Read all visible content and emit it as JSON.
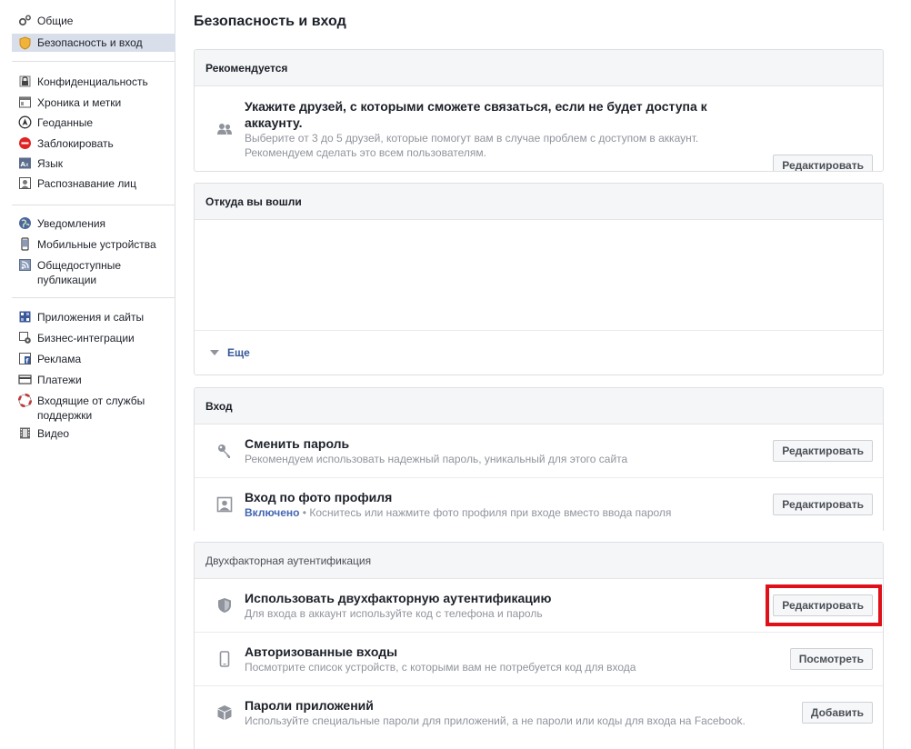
{
  "sidebar": {
    "group1": [
      {
        "label": "Общие",
        "icon": "gears-icon"
      },
      {
        "label": "Безопасность и вход",
        "icon": "shield-badge-icon",
        "active": true
      }
    ],
    "group2": [
      {
        "label": "Конфиденциальность",
        "icon": "lock-icon"
      },
      {
        "label": "Хроника и метки",
        "icon": "timeline-icon"
      },
      {
        "label": "Геоданные",
        "icon": "location-icon"
      },
      {
        "label": "Заблокировать",
        "icon": "block-icon"
      },
      {
        "label": "Язык",
        "icon": "language-icon"
      },
      {
        "label": "Распознавание лиц",
        "icon": "face-recognition-icon"
      }
    ],
    "group3": [
      {
        "label": "Уведомления",
        "icon": "globe-icon"
      },
      {
        "label": "Мобильные устройства",
        "icon": "mobile-icon"
      },
      {
        "label": "Общедоступные публикации",
        "icon": "rss-icon"
      }
    ],
    "group4": [
      {
        "label": "Приложения и сайты",
        "icon": "apps-icon"
      },
      {
        "label": "Бизнес-интеграции",
        "icon": "business-icon"
      },
      {
        "label": "Реклама",
        "icon": "ads-icon"
      },
      {
        "label": "Платежи",
        "icon": "payments-icon"
      },
      {
        "label": "Входящие от службы поддержки",
        "icon": "lifebuoy-icon"
      },
      {
        "label": "Видео",
        "icon": "film-icon"
      }
    ]
  },
  "main": {
    "title": "Безопасность и вход",
    "recommended": {
      "header": "Рекомендуется",
      "title": "Укажите друзей, с которыми сможете связаться, если не будет доступа к аккаунту.",
      "desc": "Выберите от 3 до 5 друзей, которые помогут вам в случае проблем с доступом в аккаунт. Рекомендуем сделать это всем пользователям.",
      "button": "Редактировать"
    },
    "where": {
      "header": "Откуда вы вошли",
      "more": "Еще"
    },
    "login": {
      "header": "Вход",
      "rows": [
        {
          "title": "Сменить пароль",
          "desc": "Рекомендуем использовать надежный пароль, уникальный для этого сайта",
          "button": "Редактировать",
          "icon": "key-icon"
        },
        {
          "title": "Вход по фото профиля",
          "status": "Включено",
          "desc": " • Коснитесь или нажмите фото профиля при входе вместо ввода пароля",
          "button": "Редактировать",
          "icon": "profile-photo-icon"
        }
      ]
    },
    "twofactor": {
      "header": "Двухфакторная аутентификация",
      "rows": [
        {
          "title": "Использовать двухфакторную аутентификацию",
          "desc": "Для входа в аккаунт используйте код с телефона и пароль",
          "button": "Редактировать",
          "icon": "shield-icon"
        },
        {
          "title": "Авторизованные входы",
          "desc": "Посмотрите список устройств, с которыми вам не потребуется код для входа",
          "button": "Посмотреть",
          "icon": "phone-icon"
        },
        {
          "title": "Пароли приложений",
          "desc": "Используйте специальные пароли для приложений, а не пароли или коды для входа на Facebook.",
          "button": "Добавить",
          "icon": "cube-icon"
        }
      ]
    }
  }
}
